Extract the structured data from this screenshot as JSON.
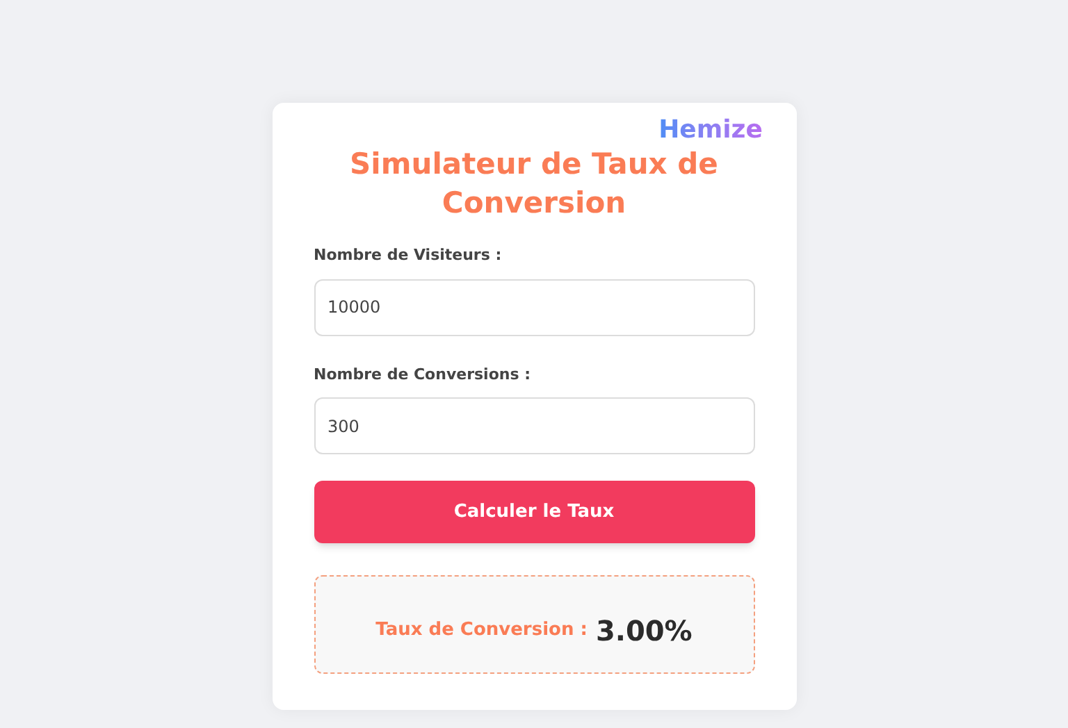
{
  "logo": "Hemize",
  "title": "Simulateur de Taux de Conversion",
  "fields": [
    {
      "label": "Nombre de Visiteurs :",
      "value": "10000"
    },
    {
      "label": "Nombre de Conversions :",
      "value": "300"
    }
  ],
  "button": "Calculer le Taux",
  "result": {
    "label": "Taux de Conversion :",
    "value": "3.00%"
  }
}
